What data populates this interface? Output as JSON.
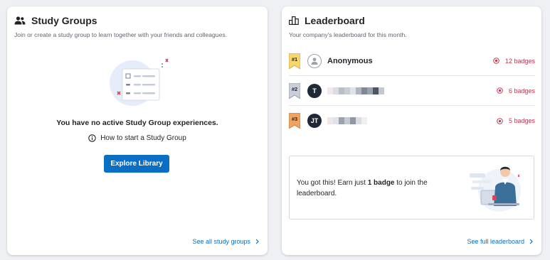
{
  "study_groups": {
    "title": "Study Groups",
    "subtitle": "Join or create a study group to learn together with your friends and colleagues.",
    "empty_message": "You have no active Study Group experiences.",
    "howto_label": "How to start a Study Group",
    "explore_button": "Explore Library",
    "footer_link": "See all study groups"
  },
  "leaderboard": {
    "title": "Leaderboard",
    "subtitle": "Your company's leaderboard for this month.",
    "entries": [
      {
        "rank": "#1",
        "avatar": "",
        "name": "Anonymous",
        "badges": "12 badges"
      },
      {
        "rank": "#2",
        "avatar": "T",
        "name": "",
        "badges": "6 badges"
      },
      {
        "rank": "#3",
        "avatar": "JT",
        "name": "",
        "badges": "5 badges"
      }
    ],
    "promo": {
      "text_before": "You got this! Earn just ",
      "text_bold": "1 badge",
      "text_after": " to join the leaderboard."
    },
    "footer_link": "See full leaderboard"
  },
  "colors": {
    "accent": "#0a6fc2",
    "badge": "#c8344f",
    "rank1": "#f7d66b",
    "rank2": "#c9cfd8",
    "rank3": "#f0a45f"
  }
}
